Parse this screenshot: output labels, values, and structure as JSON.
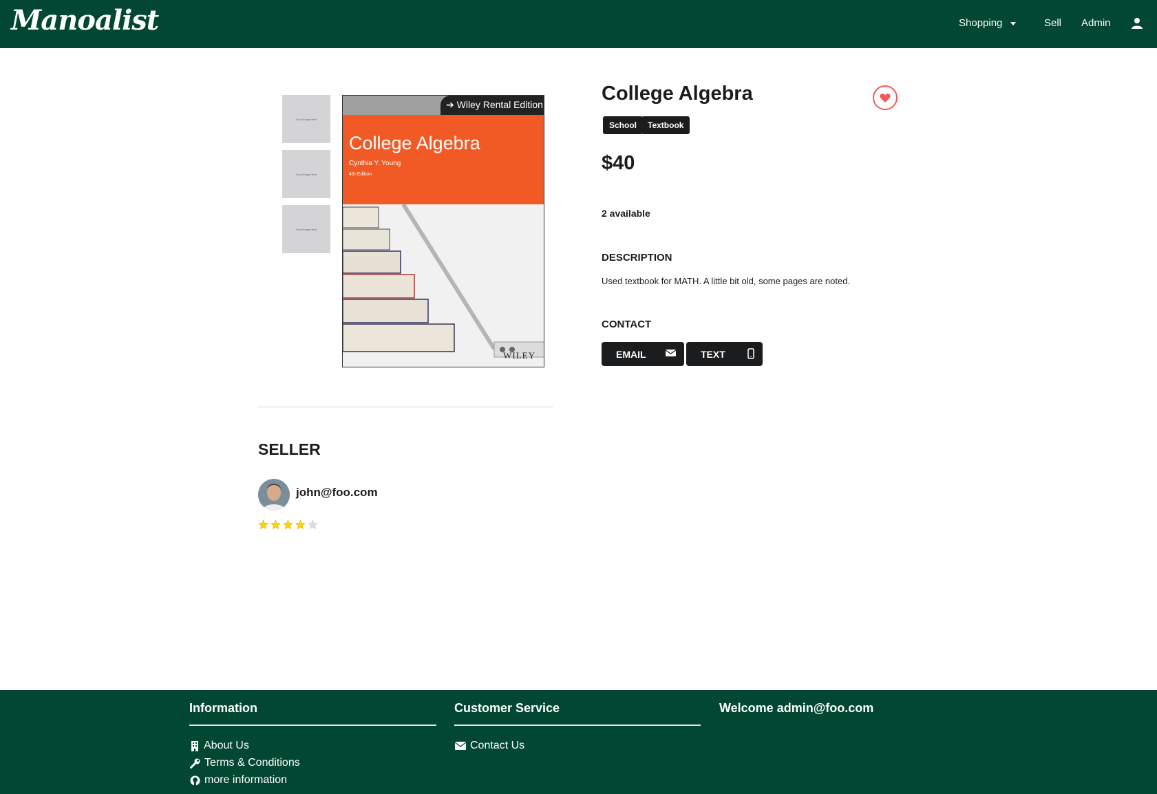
{
  "nav": {
    "logo": "Manoalist",
    "shopping": "Shopping",
    "sell": "Sell",
    "admin": "Admin"
  },
  "gallery": {
    "thumb_placeholder": "Your Image Here",
    "cover": {
      "series": "Wiley Rental Edition",
      "title": "College Algebra",
      "author": "Cynthia Y. Young",
      "edition": "4th Edition",
      "publisher": "WILEY"
    }
  },
  "product": {
    "title": "College Algebra",
    "tags": [
      "School",
      "Textbook"
    ],
    "price": "$40",
    "availability": "2 available",
    "description_heading": "DESCRIPTION",
    "description": "Used textbook for MATH. A little bit old, some pages are noted.",
    "contact_heading": "CONTACT",
    "email_label": "EMAIL",
    "text_label": "TEXT"
  },
  "seller": {
    "heading": "SELLER",
    "email": "john@foo.com",
    "rating": 4,
    "rating_max": 5
  },
  "footer": {
    "information_title": "Information",
    "about": "About Us",
    "terms": "Terms & Conditions",
    "more": "more information",
    "customer_title": "Customer Service",
    "contact": "Contact Us",
    "welcome": "Welcome admin@foo.com"
  },
  "colors": {
    "brand_green": "#024731",
    "heart_red": "#f25858",
    "star_gold": "#fbd40f"
  }
}
